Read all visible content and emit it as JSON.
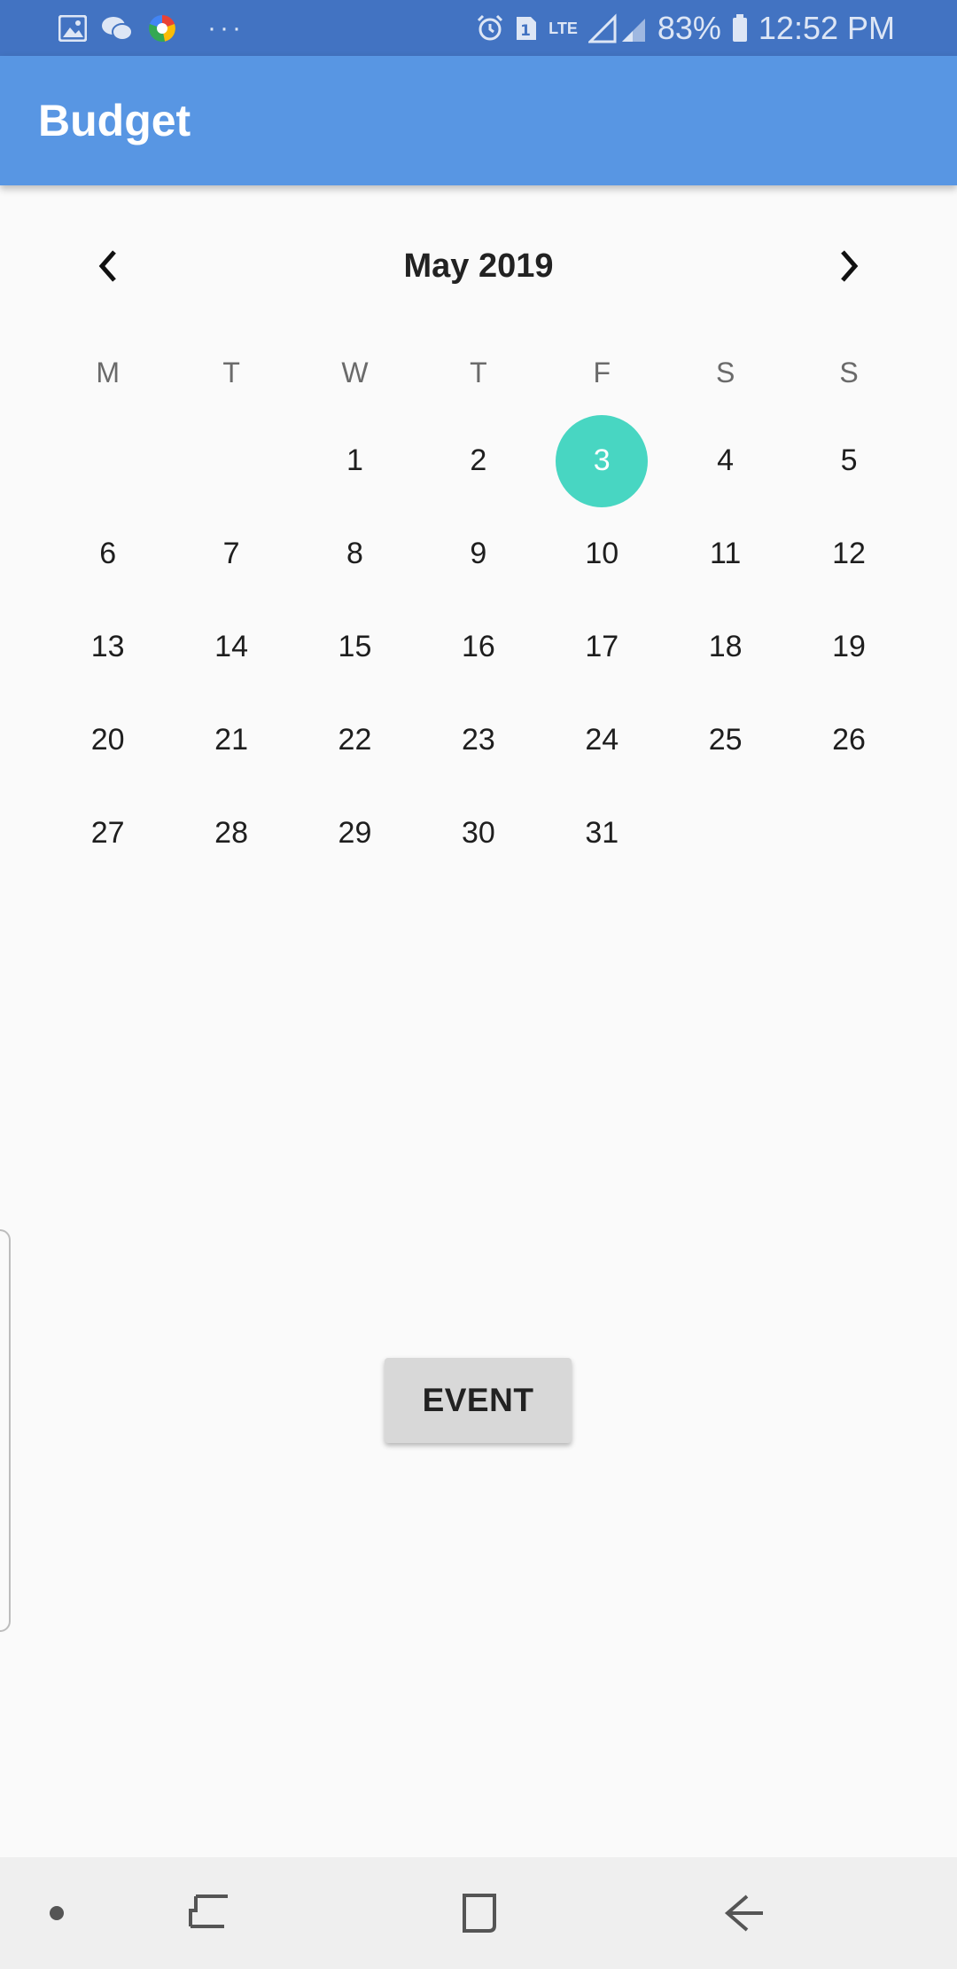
{
  "status_bar": {
    "battery": "83%",
    "time": "12:52 PM",
    "network": "LTE",
    "sim": "1",
    "more": "···",
    "left_icons": [
      "gallery-icon",
      "wechat-icon",
      "chrome-icon"
    ],
    "right_icons": [
      "alarm-icon",
      "sim-icon",
      "lte-icon",
      "signal-icon",
      "battery-icon"
    ]
  },
  "app_bar": {
    "title": "Budget"
  },
  "calendar": {
    "month_label": "May 2019",
    "weekdays": [
      "M",
      "T",
      "W",
      "T",
      "F",
      "S",
      "S"
    ],
    "weeks": [
      [
        "",
        "",
        "1",
        "2",
        "3",
        "4",
        "5"
      ],
      [
        "6",
        "7",
        "8",
        "9",
        "10",
        "11",
        "12"
      ],
      [
        "13",
        "14",
        "15",
        "16",
        "17",
        "18",
        "19"
      ],
      [
        "20",
        "21",
        "22",
        "23",
        "24",
        "25",
        "26"
      ],
      [
        "27",
        "28",
        "29",
        "30",
        "31",
        "",
        ""
      ]
    ],
    "selected_day": "3",
    "selected_color": "#48d6c2"
  },
  "actions": {
    "event_label": "EVENT"
  },
  "colors": {
    "status_bar": "#4273c2",
    "app_bar": "#5896e3",
    "background": "#fafafa",
    "button": "#d8d8d8"
  },
  "nav_bar": {
    "items": [
      "dot-icon",
      "recent-apps-icon",
      "home-icon",
      "back-icon"
    ]
  }
}
